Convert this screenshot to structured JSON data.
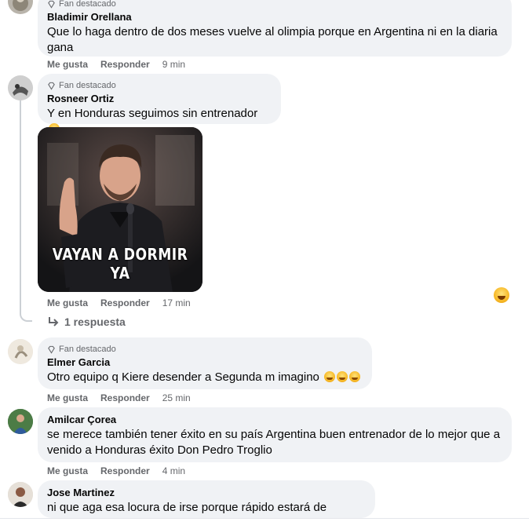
{
  "comments": [
    {
      "badge": "Fan destacado",
      "author": "Bladimir Orellana",
      "text_line1": "Que lo haga dentro de dos meses vuelve al olimpia porque en Argentina ni en la diaria",
      "text_line2": "gana",
      "like": "Me gusta",
      "reply": "Responder",
      "time": "9 min"
    },
    {
      "badge": "Fan destacado",
      "author": "Rosneer Ortiz",
      "text": "Y en Honduras seguimos sin entrenador",
      "emoji": "smiling-face-with-hearts",
      "like": "Me gusta",
      "reply": "Responder",
      "time": "17 min",
      "meme_caption": "VAYAN A DORMIR YA",
      "replies_link": "1 respuesta"
    },
    {
      "badge": "Fan destacado",
      "author": "Elmer Garcia",
      "text": "Otro equipo q Kiere desender a Segunda m imagino",
      "emoji": "rolling-on-floor-laughing x3",
      "like": "Me gusta",
      "reply": "Responder",
      "time": "25 min"
    },
    {
      "author": "Amilcar Çorea",
      "text_line1": "se merece también tener éxito en su país Argentina buen entrenador de lo mejor que a",
      "text_line2": "venido a Honduras éxito Don Pedro Troglio",
      "like": "Me gusta",
      "reply": "Responder",
      "time": "4 min"
    },
    {
      "author": "Jose Martinez",
      "text": "ni que aga esa locura de irse porque rápido estará de regreso"
    }
  ],
  "colors": {
    "bubble": "#f0f2f5",
    "secondary_text": "#65676b",
    "thread_line": "#ccd0d5"
  }
}
